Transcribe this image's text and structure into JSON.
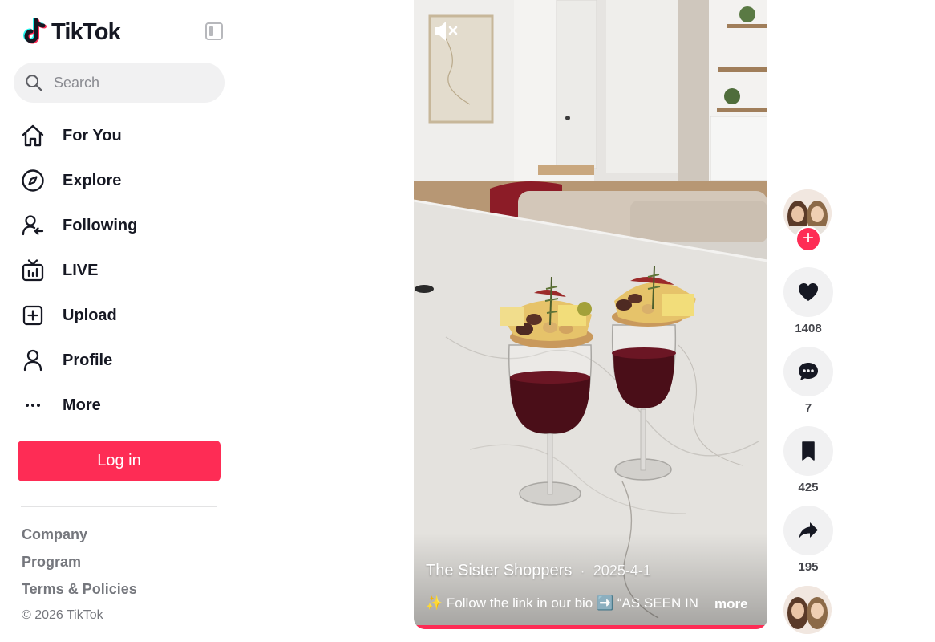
{
  "brand": {
    "name": "TikTok"
  },
  "search": {
    "placeholder": "Search"
  },
  "nav": [
    {
      "label": "For You",
      "icon": "home-icon"
    },
    {
      "label": "Explore",
      "icon": "compass-icon"
    },
    {
      "label": "Following",
      "icon": "following-icon"
    },
    {
      "label": "LIVE",
      "icon": "live-icon"
    },
    {
      "label": "Upload",
      "icon": "upload-icon"
    },
    {
      "label": "Profile",
      "icon": "profile-icon"
    },
    {
      "label": "More",
      "icon": "more-icon"
    }
  ],
  "login": {
    "label": "Log in"
  },
  "footer": {
    "links": [
      "Company",
      "Program",
      "Terms & Policies"
    ],
    "copyright": "© 2026 TikTok"
  },
  "video": {
    "creator": "The Sister Shoppers",
    "separator": "·",
    "date": "2025-4-1",
    "description": "✨ Follow the link in our bio ➡️ “AS SEEN IN",
    "more_label": "more",
    "muted": true
  },
  "actions": {
    "likes": "1408",
    "comments": "7",
    "saves": "425",
    "shares": "195"
  },
  "colors": {
    "accent": "#fe2c55",
    "text": "#161823",
    "muted_text": "#75777d",
    "button_bg": "#f1f1f2"
  }
}
